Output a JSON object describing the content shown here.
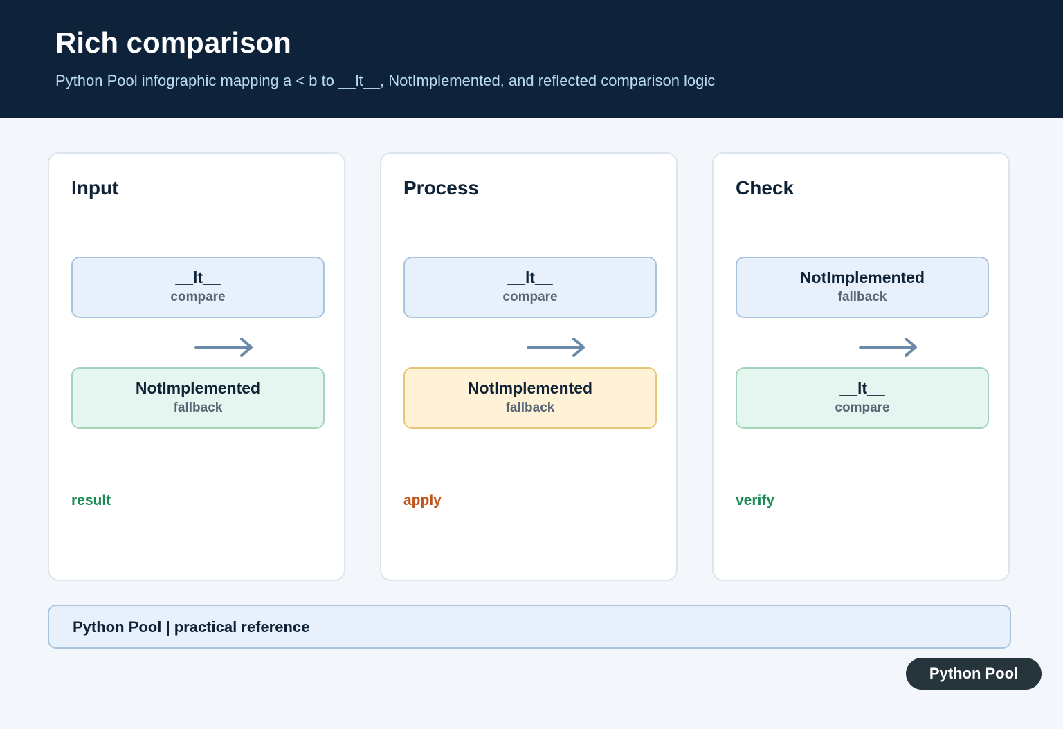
{
  "header": {
    "title": "Rich comparison",
    "subtitle": "Python Pool infographic mapping a < b to __lt__, NotImplemented, and reflected comparison logic"
  },
  "panels": [
    {
      "title": "Input",
      "top": {
        "main": "__lt__",
        "sub": "compare",
        "color": "#e7f0fb"
      },
      "bottom": {
        "main": "NotImplemented",
        "sub": "fallback",
        "color": "#e5f5ef"
      },
      "tag": "result",
      "tag_color": "#1b8a55"
    },
    {
      "title": "Process",
      "top": {
        "main": "__lt__",
        "sub": "compare",
        "color": "#e7f0fb"
      },
      "bottom": {
        "main": "NotImplemented",
        "sub": "fallback",
        "color": "#fff2d6"
      },
      "tag": "apply",
      "tag_color": "#c0531b"
    },
    {
      "title": "Check",
      "top": {
        "main": "NotImplemented",
        "sub": "fallback",
        "color": "#e7f0fb"
      },
      "bottom": {
        "main": "__lt__",
        "sub": "compare",
        "color": "#e5f5ef"
      },
      "tag": "verify",
      "tag_color": "#1b8a55"
    }
  ],
  "arrow_color": "#6a8aa8",
  "footer": {
    "text": "Python Pool | practical reference"
  },
  "badge": {
    "label": "Python Pool"
  }
}
